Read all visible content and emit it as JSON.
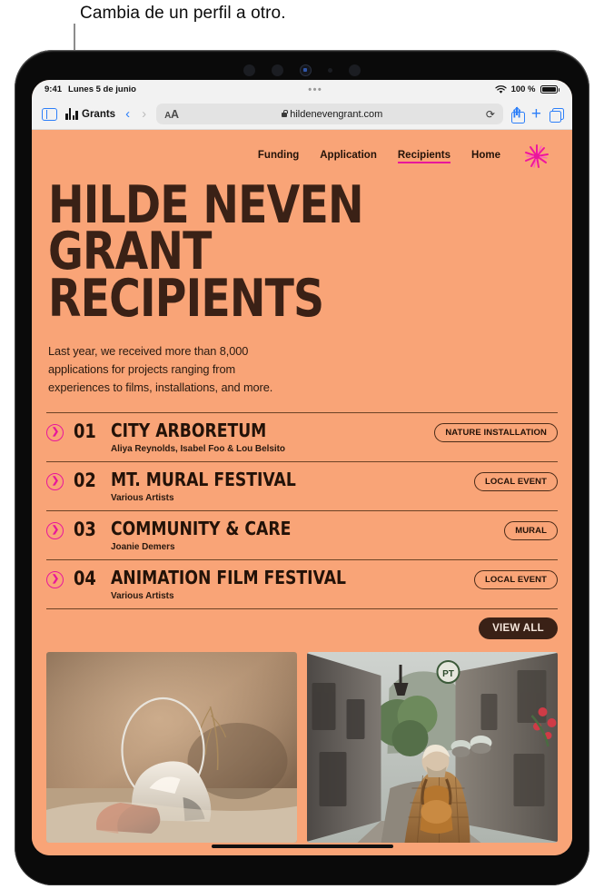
{
  "callout": {
    "text": "Cambia de un perfil a otro."
  },
  "status_bar": {
    "time": "9:41",
    "date": "Lunes 5 de junio",
    "center_dots": "•••",
    "battery_percent": "100 %",
    "wifi_icon": "wifi-icon"
  },
  "toolbar": {
    "sidebar_icon": "sidebar-icon",
    "profile_label": "Grants",
    "profile_icon": "grants-profile-icon",
    "back_label": "‹",
    "forward_label": "›",
    "aa_small": "A",
    "aa_large": "A",
    "url": "hildenevengrant.com",
    "lock_icon": "lock-icon",
    "reload_icon": "⟳",
    "share_icon": "share-icon",
    "plus_label": "+",
    "tabs_icon": "tabs-icon"
  },
  "site": {
    "nav": [
      {
        "label": "Funding",
        "active": false
      },
      {
        "label": "Application",
        "active": false
      },
      {
        "label": "Recipients",
        "active": true
      },
      {
        "label": "Home",
        "active": false
      }
    ],
    "logo_icon": "flower-starburst-logo",
    "hero_title": "HILDE NEVEN\nGRANT RECIPIENTS",
    "hero_sub": "Last year, we received more than 8,000\napplications for projects ranging from\nexperiences to films, installations, and more.",
    "recipients": [
      {
        "arrow": "❯",
        "number": "01",
        "title": "CITY ARBORETUM",
        "people": "Aliya Reynolds, Isabel Foo & Lou Belsito",
        "badge": "NATURE INSTALLATION"
      },
      {
        "arrow": "❯",
        "number": "02",
        "title": "MT. MURAL FESTIVAL",
        "people": "Various Artists",
        "badge": "LOCAL EVENT"
      },
      {
        "arrow": "❯",
        "number": "03",
        "title": "COMMUNITY & CARE",
        "people": "Joanie Demers",
        "badge": "MURAL"
      },
      {
        "arrow": "❯",
        "number": "04",
        "title": "ANIMATION FILM FESTIVAL",
        "people": "Various Artists",
        "badge": "LOCAL EVENT"
      }
    ],
    "view_all_label": "VIEW ALL",
    "photos": [
      {
        "name": "photo-still-life-brick-plaster"
      },
      {
        "name": "photo-alley-walker-backpack"
      }
    ]
  },
  "colors": {
    "page_background": "#F9A477",
    "ink": "#231208",
    "accent_pink": "#E8179B",
    "dark_brown": "#3A2116",
    "safari_blue": "#2D7FF9"
  }
}
